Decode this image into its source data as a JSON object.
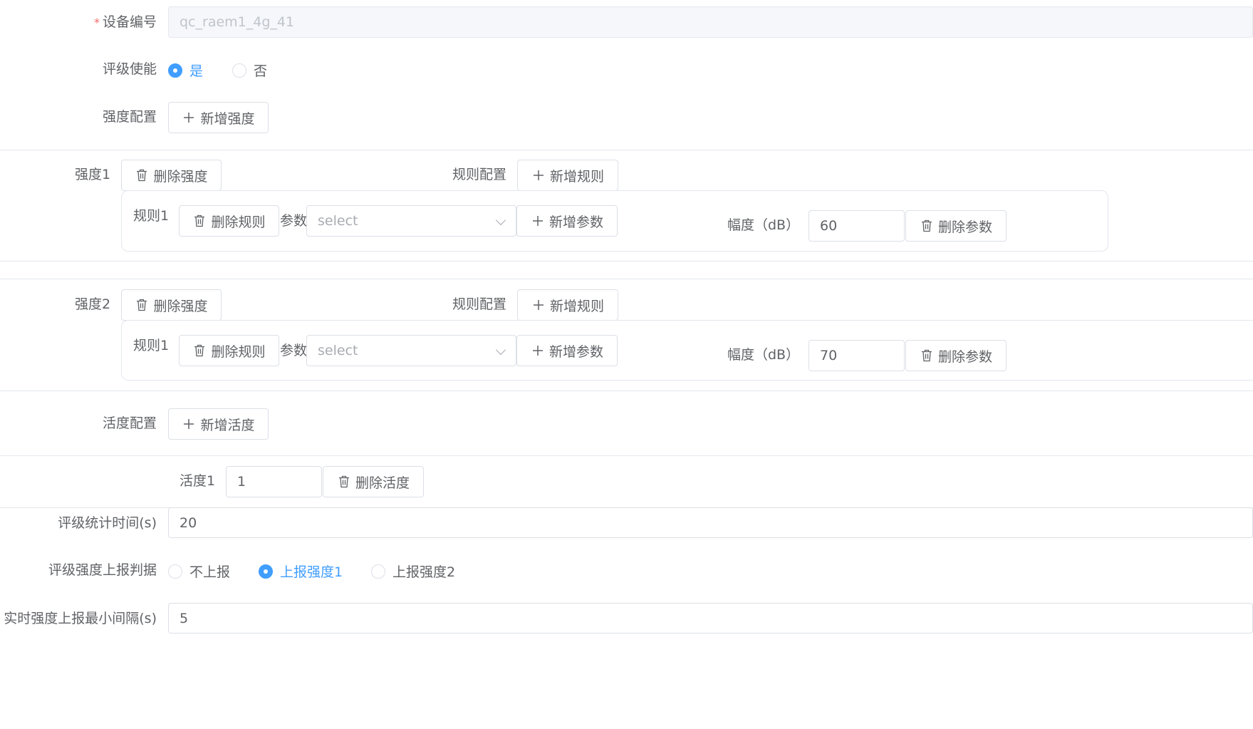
{
  "device": {
    "label": "设备编号",
    "required_mark": "*",
    "value": "qc_raem1_4g_41"
  },
  "rating_enable": {
    "label": "评级使能",
    "options": [
      {
        "label": "是",
        "checked": true
      },
      {
        "label": "否",
        "checked": false
      }
    ]
  },
  "intensity_config": {
    "label": "强度配置",
    "add_button": "新增强度"
  },
  "intensities": [
    {
      "label": "强度1",
      "delete_button": "删除强度",
      "rule_config_label": "规则配置",
      "add_rule_button": "新增规则",
      "rule": {
        "label": "规则1",
        "delete_button": "删除规则",
        "param_label": "参数",
        "select_placeholder": "select",
        "add_param_button": "新增参数",
        "amplitude_label": "幅度（dB）",
        "amplitude_value": "60",
        "delete_param_button": "删除参数"
      }
    },
    {
      "label": "强度2",
      "delete_button": "删除强度",
      "rule_config_label": "规则配置",
      "add_rule_button": "新增规则",
      "rule": {
        "label": "规则1",
        "delete_button": "删除规则",
        "param_label": "参数",
        "select_placeholder": "select",
        "add_param_button": "新增参数",
        "amplitude_label": "幅度（dB）",
        "amplitude_value": "70",
        "delete_param_button": "删除参数"
      }
    }
  ],
  "activity_config": {
    "label": "活度配置",
    "add_button": "新增活度"
  },
  "activity": {
    "label": "活度1",
    "value": "1",
    "delete_button": "删除活度"
  },
  "stat_time": {
    "label": "评级统计时间(s)",
    "value": "20"
  },
  "report_basis": {
    "label": "评级强度上报判据",
    "options": [
      {
        "label": "不上报",
        "checked": false
      },
      {
        "label": "上报强度1",
        "checked": true
      },
      {
        "label": "上报强度2",
        "checked": false
      }
    ]
  },
  "min_interval": {
    "label": "实时强度上报最小间隔(s)",
    "value": "5"
  },
  "colors": {
    "primary": "#409eff",
    "border": "#dcdfe6",
    "text": "#606266",
    "required": "#f56c6c"
  },
  "icons": {
    "plus": "plus-icon",
    "delete": "trash-icon",
    "dropdown": "chevron-down-icon"
  }
}
